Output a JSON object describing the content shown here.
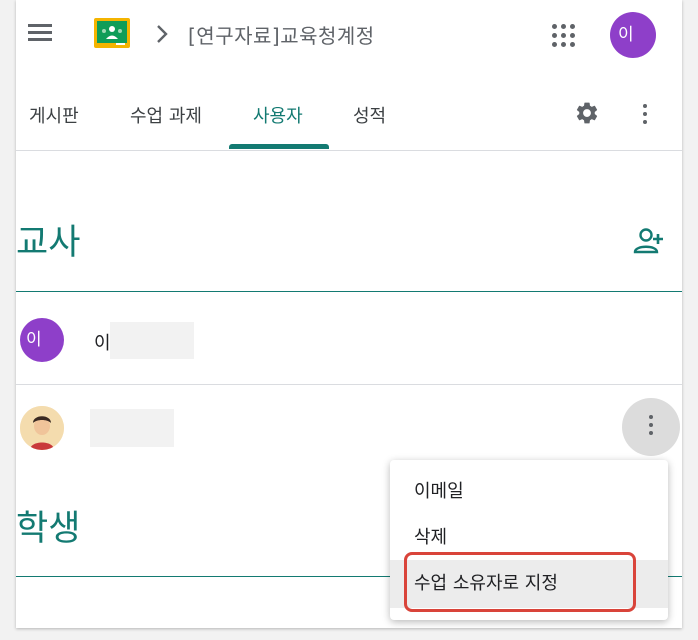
{
  "header": {
    "class_title": "[연구자료]교육청계정",
    "avatar_initial": "이",
    "icons": [
      "menu-icon",
      "classroom-logo-icon",
      "chevron-right-icon",
      "apps-grid-icon"
    ]
  },
  "tabs": [
    {
      "label": "게시판",
      "active": false
    },
    {
      "label": "수업 과제",
      "active": false
    },
    {
      "label": "사용자",
      "active": true
    },
    {
      "label": "성적",
      "active": false
    }
  ],
  "tab_icons": [
    "gear-icon",
    "more-vert-icon"
  ],
  "teachers": {
    "title": "교사",
    "add_icon": "person-add-icon",
    "rows": [
      {
        "avatar_initial": "이",
        "name": "이"
      },
      {
        "avatar": "photo",
        "name": ""
      }
    ]
  },
  "students": {
    "title": "학생"
  },
  "context_menu": {
    "items": [
      "이메일",
      "삭제",
      "수업 소유자로 지정"
    ],
    "highlighted_item": "수업 소유자로 지정"
  },
  "colors": {
    "accent": "#137a72",
    "avatar_purple": "#8e3fc9",
    "highlight_red": "#d9443a"
  }
}
